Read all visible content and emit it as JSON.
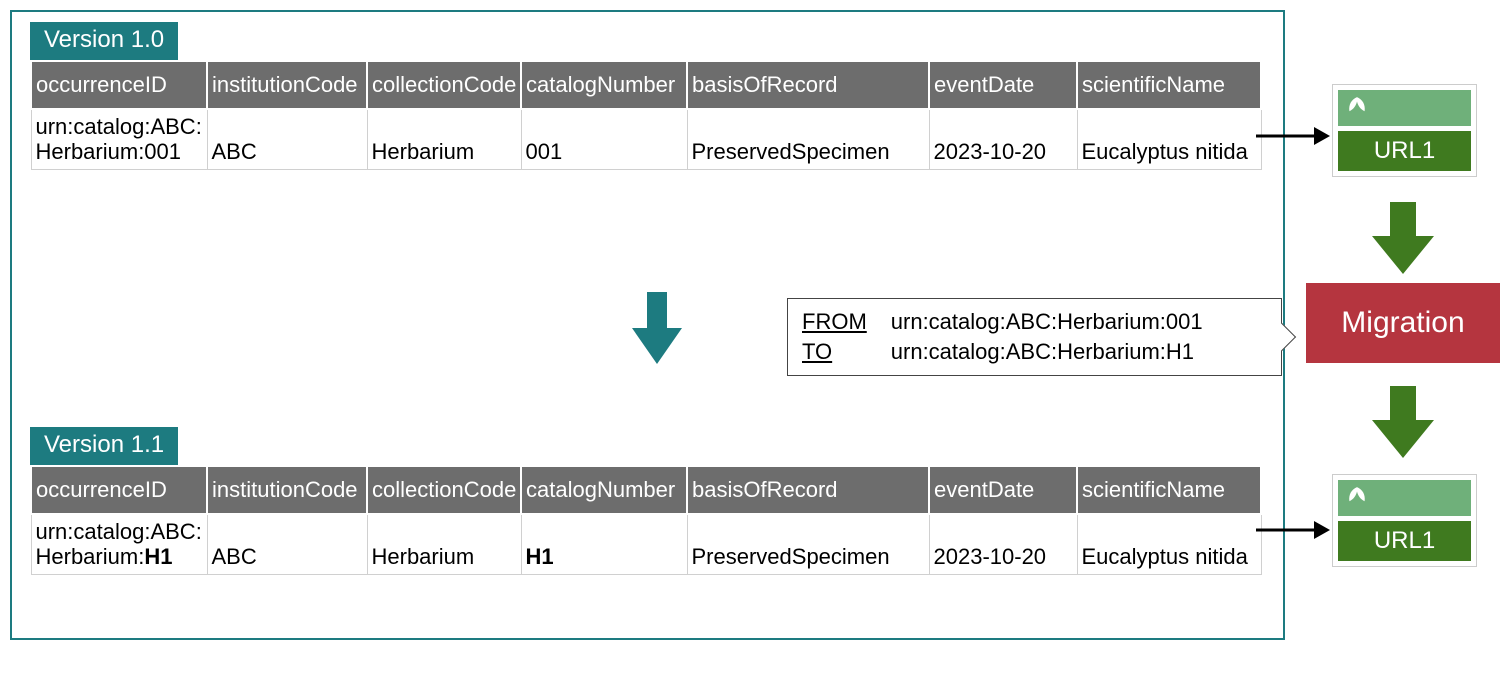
{
  "versions": {
    "v10": {
      "label": "Version 1.0"
    },
    "v11": {
      "label": "Version 1.1"
    }
  },
  "columns": {
    "c0": "occurrenceID",
    "c1": "institutionCode",
    "c2": "collectionCode",
    "c3": "catalogNumber",
    "c4": "basisOfRecord",
    "c5": "eventDate",
    "c6": "scientificName"
  },
  "row_v10": {
    "occ_l1": "urn:catalog:ABC:",
    "occ_l2": "Herbarium:001",
    "inst": "ABC",
    "coll": "Herbarium",
    "cat": "001",
    "basis": "PreservedSpecimen",
    "date": "2023-10-20",
    "sci": "Eucalyptus nitida"
  },
  "row_v11": {
    "occ_l1": "urn:catalog:ABC:",
    "occ_l2a": "Herbarium:",
    "occ_l2b": "H1",
    "inst": "ABC",
    "coll": "Herbarium",
    "cat": "H1",
    "basis": "PreservedSpecimen",
    "date": "2023-10-20",
    "sci": "Eucalyptus nitida"
  },
  "fromto": {
    "from_label": "FROM",
    "to_label": "TO",
    "from_val": "urn:catalog:ABC:Herbarium:001",
    "to_val": "urn:catalog:ABC:Herbarium:H1"
  },
  "url_cards": {
    "u1": "URL1",
    "u2": "URL1"
  },
  "migration": {
    "label": "Migration"
  }
}
